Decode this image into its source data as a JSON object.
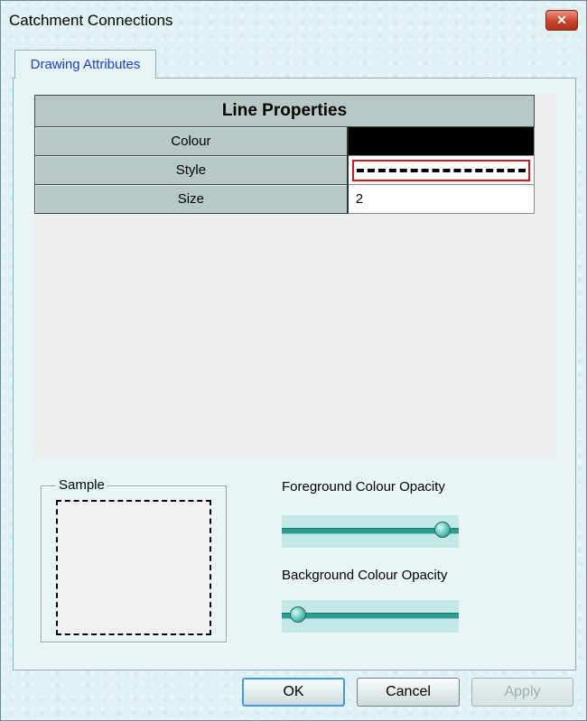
{
  "window": {
    "title": "Catchment Connections"
  },
  "tabs": [
    {
      "label": "Drawing Attributes"
    }
  ],
  "table": {
    "header": "Line Properties",
    "rows": [
      {
        "name": "Colour",
        "value": ""
      },
      {
        "name": "Style",
        "value": ""
      },
      {
        "name": "Size",
        "value": "2"
      }
    ]
  },
  "colour_value": "#000000",
  "sample": {
    "label": "Sample"
  },
  "sliders": {
    "foreground": {
      "label": "Foreground Colour Opacity",
      "value_fraction": 0.95
    },
    "background": {
      "label": "Background Colour Opacity",
      "value_fraction": 0.05
    }
  },
  "buttons": {
    "ok": "OK",
    "cancel": "Cancel",
    "apply": "Apply"
  }
}
